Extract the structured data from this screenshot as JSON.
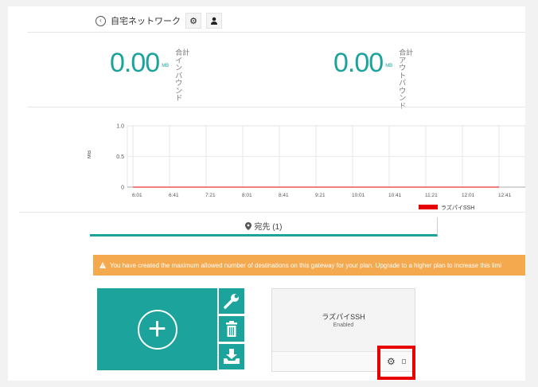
{
  "header": {
    "back_icon": "arrow-circle-left-icon",
    "title": "自宅ネットワーク",
    "settings_icon": "gear-icon",
    "user_icon": "person-icon"
  },
  "stats": {
    "inbound": {
      "value": "0.00",
      "unit": "MB",
      "label_chars": [
        "合計",
        "イ",
        "ン",
        "バ",
        "ウ",
        "ン",
        "ド"
      ]
    },
    "outbound": {
      "value": "0.00",
      "unit": "MB",
      "label_chars": [
        "合計",
        "ア",
        "ウ",
        "ト",
        "バ",
        "ウ",
        "ン",
        "ド"
      ]
    }
  },
  "chart_data": {
    "type": "line",
    "ylabel": "MB",
    "y_ticks": [
      "1.0",
      "0.5",
      "0"
    ],
    "ylim": [
      0,
      1.0
    ],
    "categories": [
      "6:01",
      "6:41",
      "7:21",
      "8:01",
      "8:41",
      "9:21",
      "10:01",
      "10:41",
      "11:21",
      "12:01",
      "12:41"
    ],
    "series": [
      {
        "name": "ラズパイSSH",
        "color": "#e60000",
        "values": [
          0,
          0,
          0,
          0,
          0,
          0,
          0,
          0,
          0,
          0,
          0
        ]
      }
    ],
    "grid": true,
    "legend_position": "bottom"
  },
  "tab": {
    "icon": "map-pin-icon",
    "label": "宛先 (1)"
  },
  "alert": {
    "icon": "warning-icon",
    "text": "You have created the maximum allowed number of destinations on this gateway for your plan. Upgrade to a higher plan to increase this limi"
  },
  "add_card": {
    "icon": "plus-circle-icon"
  },
  "side_buttons": [
    {
      "name": "configure",
      "icon": "wrench-icon"
    },
    {
      "name": "delete",
      "icon": "trash-icon"
    },
    {
      "name": "download",
      "icon": "download-tray-icon"
    }
  ],
  "destination": {
    "name": "ラズパイSSH",
    "status": "Enabled",
    "settings_icon": "gear-icon"
  },
  "colors": {
    "accent": "#1ba39c",
    "alert": "#f5a94e",
    "highlight": "#e60000"
  }
}
